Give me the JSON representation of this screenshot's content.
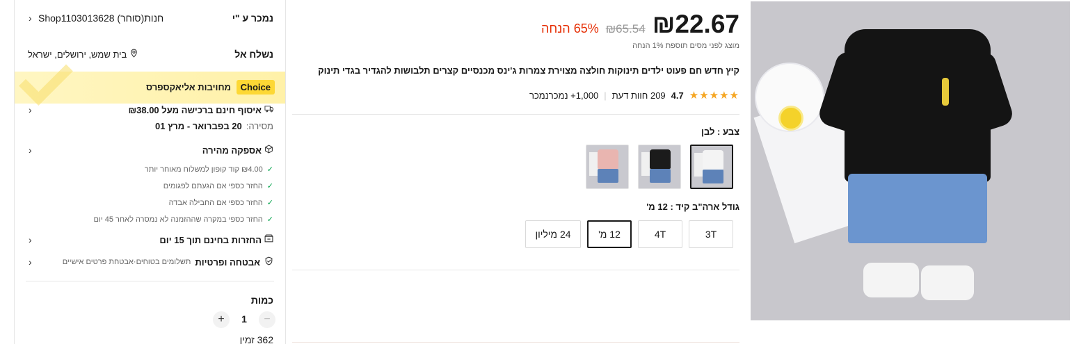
{
  "sidebar": {
    "sold_by_label": "נמכר ע \"י",
    "store_name": "Shop1103013628 חנות(סוחר)",
    "ship_to_label": "נשלח אל",
    "ship_to_location": "בית שמש, ירושלים, ישראל",
    "choice_badge": "Choice",
    "choice_text": "מחויבות אליאקספרס",
    "pickup_text": "איסוף חינם ברכישה מעל ₪38.00",
    "delivery_label": "מסירה:",
    "delivery_range": "20 בפברואר - מרץ 01",
    "fast_shipping": "אספקה מהירה",
    "guarantees": [
      "₪4.00 קוד קופון למשלוח מאוחר יותר",
      "החזר כספי אם הגעתם לפגומים",
      "החזר כספי אם החבילה אבדה",
      "החזר כספי במקרה שההזמנה לא נמסרה לאחר 45 יום"
    ],
    "returns_text": "החזרות בחינם תוך 15 יום",
    "security_title": "אבטחה ופרטיות",
    "security_text": "תשלומים בטוחים·אבטחת פרטים אישיים",
    "quantity_label": "כמות",
    "quantity_value": "1",
    "plus": "+",
    "minus": "−",
    "stock_text": "362 זמין"
  },
  "product": {
    "price": "₪22.67",
    "old_price": "₪65.54",
    "discount": "65% הנחה",
    "tax_note": "מוצג לפני מסים תוספת 1% הנחה",
    "title": "קיץ חדש חם פעוט ילדים תינוקות חולצה מצוירת צמרות ג'ינס מכנסיים קצרים תלבושות להגדיר בגדי תינוק",
    "stars": "★★★★★",
    "rating": "4.7",
    "reviews": "209 חוות דעת",
    "sold": "1,000+ נמכרנמכר",
    "color_label": "צבע : לבן",
    "color_options": [
      {
        "name": "white",
        "shirt": "#f4f4f4"
      },
      {
        "name": "black",
        "shirt": "#1b1b1b"
      },
      {
        "name": "pink",
        "shirt": "#e9b5b0"
      }
    ],
    "size_label": "גודל ארה\"ב קיד : 12 מ'",
    "sizes": [
      "3T",
      "4T",
      "12 מ'",
      "24 מיליון"
    ],
    "selected_size": "12 מ'"
  },
  "colors": {
    "price_text": "#191919",
    "discount": "#e62e04",
    "choice_yellow": "#fdd835",
    "stars": "#f5a623",
    "check": "#00a34a"
  }
}
